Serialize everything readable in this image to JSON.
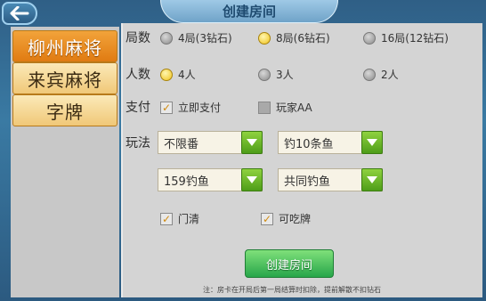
{
  "header": {
    "title": "创建房间",
    "back_icon": "back-arrow-icon"
  },
  "tabs": [
    {
      "label": "柳州麻将",
      "active": true
    },
    {
      "label": "来宾麻将",
      "active": false
    },
    {
      "label": "字牌",
      "active": false
    }
  ],
  "rounds": {
    "label": "局数",
    "options": [
      {
        "label": "4局(3钻石)",
        "selected": false
      },
      {
        "label": "8局(6钻石)",
        "selected": true
      },
      {
        "label": "16局(12钻石)",
        "selected": false
      }
    ]
  },
  "players": {
    "label": "人数",
    "options": [
      {
        "label": "4人",
        "selected": true
      },
      {
        "label": "3人",
        "selected": false
      },
      {
        "label": "2人",
        "selected": false
      }
    ]
  },
  "payment": {
    "label": "支付",
    "options": [
      {
        "label": "立即支付",
        "checked": true
      },
      {
        "label": "玩家AA",
        "checked": false
      }
    ]
  },
  "rules": {
    "label": "玩法",
    "dropdowns": [
      {
        "value": "不限番"
      },
      {
        "value": "钓10条鱼"
      },
      {
        "value": "159钓鱼"
      },
      {
        "value": "共同钓鱼"
      }
    ],
    "checkboxes": [
      {
        "label": "门清",
        "checked": true
      },
      {
        "label": "可吃牌",
        "checked": true
      }
    ]
  },
  "create_button": {
    "label": "创建房间"
  },
  "note": "注：房卡在开局后第一局结算时扣除，提前解散不扣钻石",
  "colors": {
    "accent_orange": "#e88a1e",
    "accent_green": "#3fae3a",
    "frame_blue": "#3a7aa3"
  }
}
